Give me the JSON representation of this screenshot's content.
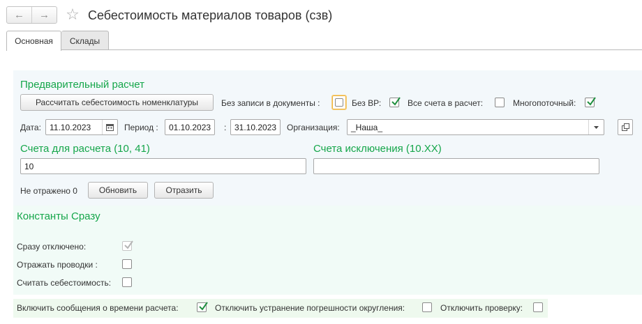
{
  "window": {
    "title": "Себестоимость материалов товаров (сзв)"
  },
  "nav": {
    "back_glyph": "←",
    "forward_glyph": "→",
    "favorite_glyph": "☆"
  },
  "tabs": [
    {
      "label": "Основная",
      "active": true
    },
    {
      "label": "Склады",
      "active": false
    }
  ],
  "prelim": {
    "header": "Предварительный расчет",
    "calc_button": "Рассчитать себестоимость номенклатуры",
    "no_write_label": "Без записи в документы :",
    "no_write_checked": false,
    "no_vr_label": "Без ВР:",
    "no_vr_checked": true,
    "all_accounts_label": "Все счета в расчет:",
    "all_accounts_checked": false,
    "multithread_label": "Многопоточный:",
    "multithread_checked": true,
    "date_label": "Дата:",
    "date_value": "11.10.2023",
    "period_label": "Период :",
    "period_from": "01.10.2023",
    "period_sep": ":",
    "period_to": "31.10.2023",
    "org_label": "Организация:",
    "org_value": "_Наша_",
    "accounts_header": "Счета для расчета (10, 41)",
    "accounts_value": "10",
    "exceptions_header": "Счета исключения (10.XX)",
    "exceptions_value": "",
    "not_reflected": "Не отражено 0",
    "refresh_button": "Обновить",
    "reflect_button": "Отразить"
  },
  "constants": {
    "header": "Константы Сразу",
    "off_label": "Сразу отключено:",
    "off_checked": true,
    "postings_label": "Отражать проводки :",
    "postings_checked": false,
    "cost_label": "Считать себестоимость:",
    "cost_checked": false
  },
  "footer": {
    "messages_label": "Включить сообщения о времени расчета:",
    "messages_checked": true,
    "rounding_label": "Отключить устранение погрешности округления:",
    "rounding_checked": false,
    "check_label": "Отключить проверку:",
    "check_checked": false
  },
  "icons": {
    "calendar": "calendar-icon",
    "dropdown": "dropdown-arrow-icon",
    "open": "open-form-icon"
  },
  "colors": {
    "accent_green": "#15a64a",
    "check_green": "#1f8f3f",
    "panel_blue": "#f3f8fb",
    "focus_orange": "#f0b43c"
  }
}
